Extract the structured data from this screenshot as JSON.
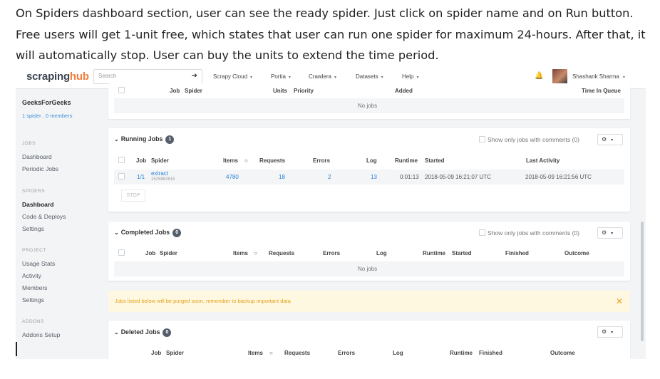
{
  "article": {
    "line1": "On Spiders dashboard section, user can see the ready spider. Just click on spider name and on Run button.",
    "line2": "Free users will get 1-unit free, which states that user can run one spider for maximum 24-hours. After that, it",
    "line3": "will automatically stop. User can buy the units to extend the time period."
  },
  "nav": {
    "logo_a": "scraping",
    "logo_b": "hub",
    "search_placeholder": "Search",
    "search_arrow": "➔",
    "menu": [
      "Scrapy Cloud",
      "Portia",
      "Crawlera",
      "Datasets",
      "Help"
    ],
    "caret": "▾",
    "bell": "🔔",
    "user": "Shashank Sharma"
  },
  "sidebar": {
    "org": "GeeksForGeeks",
    "meta": "1 spider , 0 members",
    "jobs_head": "JOBS",
    "jobs": [
      "Dashboard",
      "Periodic Jobs"
    ],
    "spiders_head": "SPIDERS",
    "spiders": [
      "Dashboard",
      "Code & Deploys",
      "Settings"
    ],
    "project_head": "PROJECT",
    "project": [
      "Usage Stats",
      "Activity",
      "Members",
      "Settings"
    ],
    "addons_head": "ADDONS",
    "addons": [
      "Addons Setup"
    ]
  },
  "scheduled": {
    "headers": {
      "job": "Job",
      "spider": "Spider",
      "units": "Units",
      "priority": "Priority",
      "added": "Added",
      "time_in_queue": "Time In Queue"
    },
    "empty": "No jobs"
  },
  "running": {
    "title": "Running Jobs",
    "count": "1",
    "show_only": "Show only jobs with comments (0)",
    "gear": "⚙",
    "headers": {
      "job": "Job",
      "spider": "Spider",
      "items": "Items",
      "requests": "Requests",
      "errors": "Errors",
      "log": "Log",
      "runtime": "Runtime",
      "started": "Started",
      "last_activity": "Last Activity"
    },
    "row": {
      "job": "1/1",
      "spider": "extract",
      "spider_id": "1525882615",
      "items": "4780",
      "requests": "18",
      "errors": "2",
      "log": "13",
      "runtime": "0:01:13",
      "started": "2018-05-09 16:21:07 UTC",
      "last_activity": "2018-05-09 16:21:56 UTC"
    },
    "stop": "STOP"
  },
  "completed": {
    "title": "Completed Jobs",
    "count": "0",
    "show_only": "Show only jobs with comments (0)",
    "headers": {
      "job": "Job",
      "spider": "Spider",
      "items": "Items",
      "requests": "Requests",
      "errors": "Errors",
      "log": "Log",
      "runtime": "Runtime",
      "started": "Started",
      "finished": "Finished",
      "outcome": "Outcome"
    },
    "empty": "No jobs"
  },
  "warning": {
    "text": "Jobs listed below will be purged soon, remember to backup important data",
    "close": "✕"
  },
  "deleted": {
    "title": "Deleted Jobs",
    "count": "0",
    "headers": {
      "job": "Job",
      "spider": "Spider",
      "items": "Items",
      "requests": "Requests",
      "errors": "Errors",
      "log": "Log",
      "runtime": "Runtime",
      "finished": "Finished",
      "outcome": "Outcome"
    }
  }
}
